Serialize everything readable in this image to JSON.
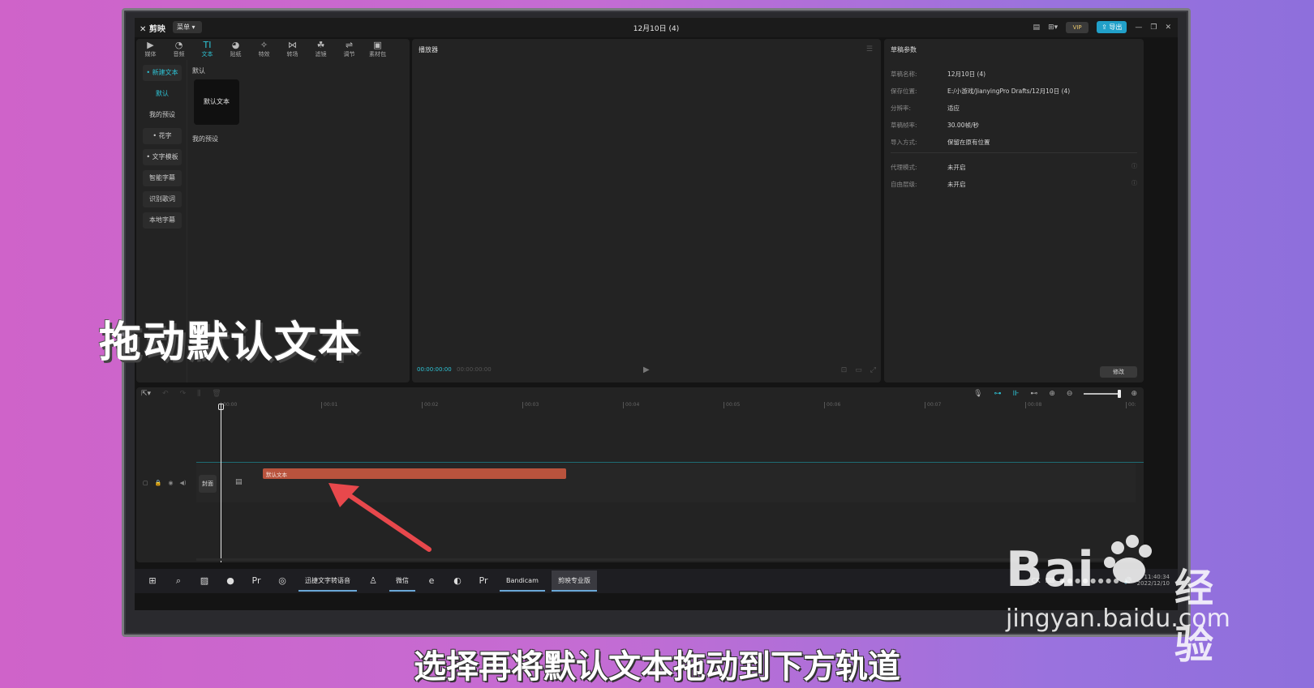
{
  "app": {
    "logo": "剪映",
    "menu_label": "菜单",
    "window_title": "12月10日 (4)",
    "export_label": "导出",
    "vip_label": "VIP"
  },
  "toolbar": {
    "tools": [
      {
        "label": "媒体",
        "icon": "media-icon"
      },
      {
        "label": "音频",
        "icon": "audio-icon"
      },
      {
        "label": "文本",
        "icon": "text-icon"
      },
      {
        "label": "贴纸",
        "icon": "sticker-icon"
      },
      {
        "label": "特效",
        "icon": "effects-icon"
      },
      {
        "label": "转场",
        "icon": "transition-icon"
      },
      {
        "label": "滤镜",
        "icon": "filter-icon"
      },
      {
        "label": "调节",
        "icon": "adjust-icon"
      },
      {
        "label": "素材包",
        "icon": "package-icon"
      }
    ]
  },
  "sidebar": {
    "items": [
      "• 新建文本",
      "默认",
      "我的预设",
      "• 花字",
      "• 文字模板",
      "智能字幕",
      "识别歌词",
      "本地字幕"
    ]
  },
  "library": {
    "section_default": "默认",
    "card_label": "默认文本",
    "section_presets": "我的预设"
  },
  "player": {
    "title": "播放器",
    "time_current": "00:00:00:00",
    "time_total": "00:00:00:00"
  },
  "properties": {
    "title": "草稿参数",
    "rows": [
      {
        "key": "草稿名称:",
        "value": "12月10日 (4)"
      },
      {
        "key": "保存位置:",
        "value": "E:/小游戏/JianyingPro Drafts/12月10日 (4)"
      },
      {
        "key": "分辨率:",
        "value": "适应"
      },
      {
        "key": "草稿帧率:",
        "value": "30.00帧/秒"
      },
      {
        "key": "导入方式:",
        "value": "保留在原有位置"
      }
    ],
    "rows2": [
      {
        "key": "代理模式:",
        "value": "未开启"
      },
      {
        "key": "自由层级:",
        "value": "未开启"
      }
    ],
    "modify_label": "修改"
  },
  "timeline": {
    "ticks": [
      "00:00",
      "00:01",
      "00:02",
      "00:03",
      "00:04",
      "00:05",
      "00:06",
      "00:07",
      "00:08",
      "00:"
    ],
    "cover_label": "封面",
    "clip_label": "默认文本"
  },
  "taskbar": {
    "apps": [
      "迅捷文字转语音",
      "微信",
      "Bandicam",
      "剪映专业版"
    ],
    "tray_lang": "CK",
    "clock_time": "11:40:34",
    "clock_date": "2022/12/10"
  },
  "overlay": {
    "caption": "拖动默认文本",
    "subtitle": "选择再将默认文本拖动到下方轨道",
    "watermark_brand": "Bai",
    "watermark_jy": "经验",
    "watermark_url": "jingyan.baidu.com"
  },
  "colors": {
    "accent": "#2ec4d6",
    "clip": "#b9533d",
    "arrow": "#e8484c",
    "export": "#21a0c9"
  }
}
